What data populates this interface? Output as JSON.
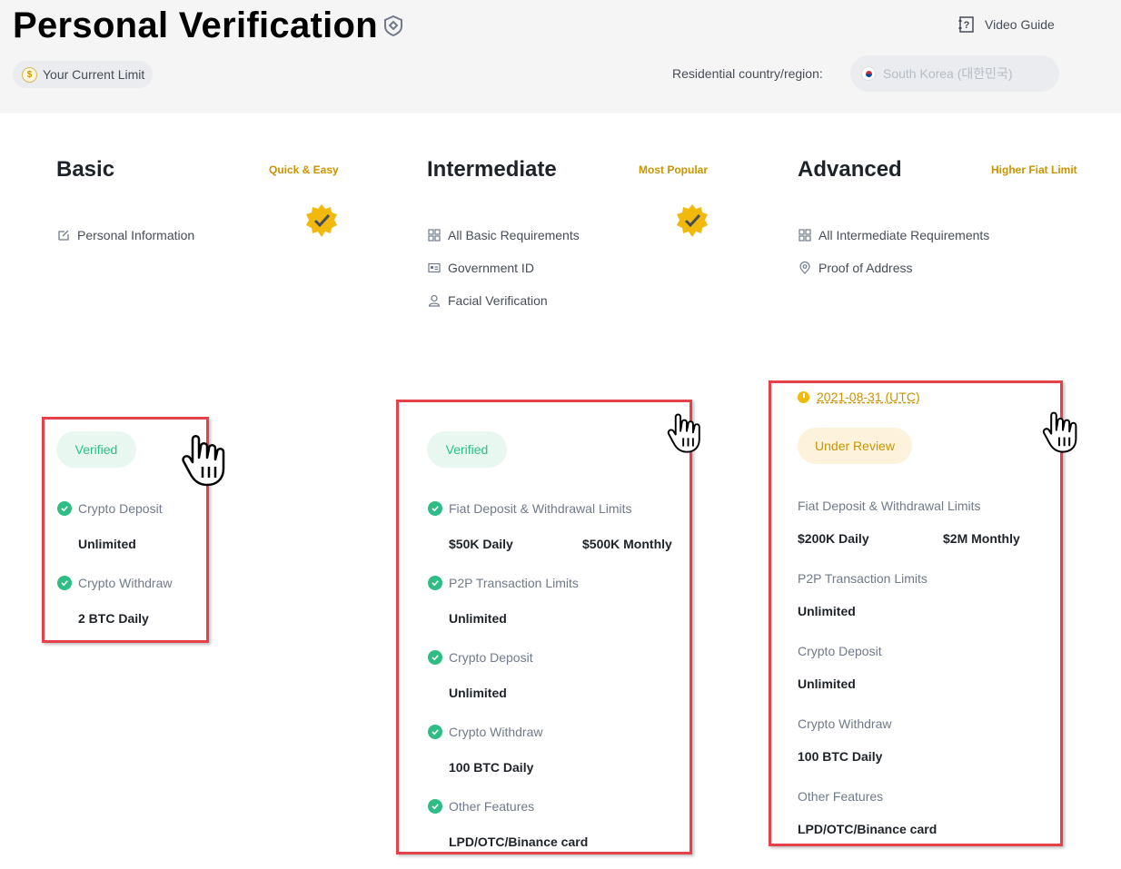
{
  "header": {
    "title": "Personal Verification",
    "video_guide": "Video Guide",
    "current_limit": "Your Current Limit",
    "country_label": "Residential country/region:",
    "country_value": "South Korea (대한민국)"
  },
  "colors": {
    "accent": "#c99400",
    "success": "#2ebd85",
    "highlight_box": "#e5414b"
  },
  "tiers": {
    "basic": {
      "title": "Basic",
      "tag": "Quick & Easy",
      "requirements": [
        "Personal Information"
      ],
      "status": "Verified",
      "features": [
        {
          "label": "Crypto Deposit",
          "value": "Unlimited"
        },
        {
          "label": "Crypto Withdraw",
          "value": "2 BTC Daily"
        }
      ]
    },
    "intermediate": {
      "title": "Intermediate",
      "tag": "Most Popular",
      "requirements": [
        "All Basic Requirements",
        "Government ID",
        "Facial Verification"
      ],
      "status": "Verified",
      "fiat": {
        "label": "Fiat Deposit & Withdrawal Limits",
        "daily": "$50K Daily",
        "monthly": "$500K Monthly"
      },
      "features": [
        {
          "label": "P2P Transaction Limits",
          "value": "Unlimited"
        },
        {
          "label": "Crypto Deposit",
          "value": "Unlimited"
        },
        {
          "label": "Crypto Withdraw",
          "value": "100 BTC Daily"
        },
        {
          "label": "Other Features",
          "value": "LPD/OTC/Binance card"
        }
      ]
    },
    "advanced": {
      "title": "Advanced",
      "tag": "Higher Fiat Limit",
      "requirements": [
        "All Intermediate Requirements",
        "Proof of Address"
      ],
      "date": "2021-08-31 (UTC)",
      "status": "Under Review",
      "fiat": {
        "label": "Fiat Deposit & Withdrawal Limits",
        "daily": "$200K Daily",
        "monthly": "$2M Monthly"
      },
      "features": [
        {
          "label": "P2P Transaction Limits",
          "value": "Unlimited"
        },
        {
          "label": "Crypto Deposit",
          "value": "Unlimited"
        },
        {
          "label": "Crypto Withdraw",
          "value": "100 BTC Daily"
        },
        {
          "label": "Other Features",
          "value": "LPD/OTC/Binance card"
        }
      ]
    }
  }
}
